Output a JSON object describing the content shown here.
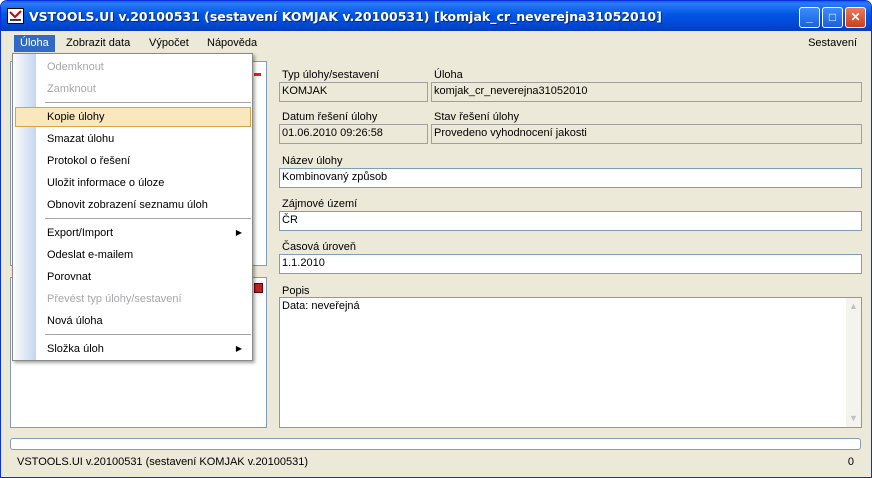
{
  "window": {
    "title": "VSTOOLS.UI v.20100531 (sestavení KOMJAK v.20100531) [komjak_cr_neverejna31052010]",
    "buttons": {
      "minimize": "_",
      "maximize": "□",
      "close": "✕"
    }
  },
  "menubar": {
    "items": [
      "Úloha",
      "Zobrazit data",
      "Výpočet",
      "Nápověda"
    ],
    "right_label": "Sestavení"
  },
  "dropdown": {
    "items": [
      {
        "label": "Odemknout",
        "disabled": true
      },
      {
        "label": "Zamknout",
        "disabled": true
      },
      {
        "label": "Kopie úlohy",
        "disabled": false
      },
      {
        "label": "Smazat úlohu",
        "disabled": false
      },
      {
        "label": "Protokol o řešení",
        "disabled": false
      },
      {
        "label": "Uložit informace o úloze",
        "disabled": false
      },
      {
        "label": "Obnovit zobrazení seznamu úloh",
        "disabled": false
      },
      {
        "label": "Export/Import",
        "disabled": false,
        "submenu": true
      },
      {
        "label": "Odeslat e-mailem",
        "disabled": false
      },
      {
        "label": "Porovnat",
        "disabled": false
      },
      {
        "label": "Převést typ úlohy/sestavení",
        "disabled": true
      },
      {
        "label": "Nová úloha",
        "disabled": false
      },
      {
        "label": "Složka úloh",
        "disabled": false,
        "submenu": true
      }
    ],
    "submenu_arrow": "▶"
  },
  "form": {
    "typ_label": "Typ úlohy/sestavení",
    "typ_value": "KOMJAK",
    "uloha_label": "Úloha",
    "uloha_value": "komjak_cr_neverejna31052010",
    "datum_label": "Datum řešení úlohy",
    "datum_value": "01.06.2010 09:26:58",
    "stav_label": "Stav řešení úlohy",
    "stav_value": "Provedeno vyhodnocení jakosti",
    "nazev_label": "Název úlohy",
    "nazev_value": "Kombinovaný způsob",
    "zajmove_label": "Zájmové území",
    "zajmove_value": "ČR",
    "casova_label": "Časová úroveň",
    "casova_value": "1.1.2010",
    "popis_label": "Popis",
    "popis_value": "Data: neveřejná"
  },
  "scroll": {
    "up": "▲",
    "down": "▼"
  },
  "status": {
    "text": "VSTOOLS.UI v.20100531 (sestavení KOMJAK v.20100531)",
    "count": "0",
    "progress": 0
  },
  "colors": {
    "titlebar": "#0055e5",
    "menu_active": "#316ac5",
    "hover_item": "#fbe7bc"
  }
}
